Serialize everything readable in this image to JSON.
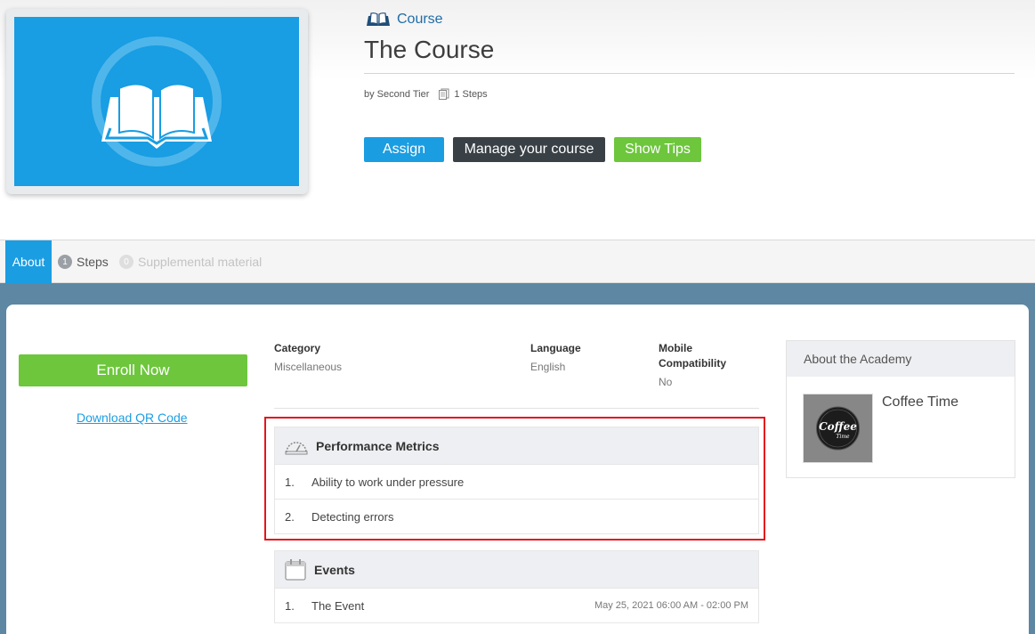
{
  "header": {
    "type_label": "Course",
    "title": "The Course",
    "author": "by Second Tier",
    "steps_count": "1 Steps"
  },
  "actions": {
    "assign": "Assign",
    "manage": "Manage your course",
    "tips": "Show Tips"
  },
  "tabs": {
    "about": "About",
    "steps": {
      "count": "1",
      "label": "Steps"
    },
    "supplemental": {
      "count": "0",
      "label": "Supplemental material"
    }
  },
  "sidebar": {
    "enroll": "Enroll Now",
    "qr": "Download QR Code"
  },
  "info": {
    "category": {
      "label": "Category",
      "value": "Miscellaneous"
    },
    "language": {
      "label": "Language",
      "value": "English"
    },
    "mobile": {
      "label": "Mobile Compatibility",
      "value": "No"
    }
  },
  "metrics": {
    "title": "Performance Metrics",
    "items": [
      {
        "num": "1.",
        "text": "Ability to work under pressure"
      },
      {
        "num": "2.",
        "text": "Detecting errors"
      }
    ]
  },
  "events": {
    "title": "Events",
    "items": [
      {
        "num": "1.",
        "text": "The Event",
        "date": "May 25, 2021 06:00 AM - 02:00 PM"
      }
    ]
  },
  "academy": {
    "title": "About the Academy",
    "name": "Coffee Time",
    "logo_text_1": "Coffee",
    "logo_text_2": "Time"
  },
  "colors": {
    "primary": "#1b9de2",
    "dark": "#394147",
    "green": "#6dc63c",
    "highlight": "#e4141b",
    "page_bg": "#5d87a2"
  }
}
